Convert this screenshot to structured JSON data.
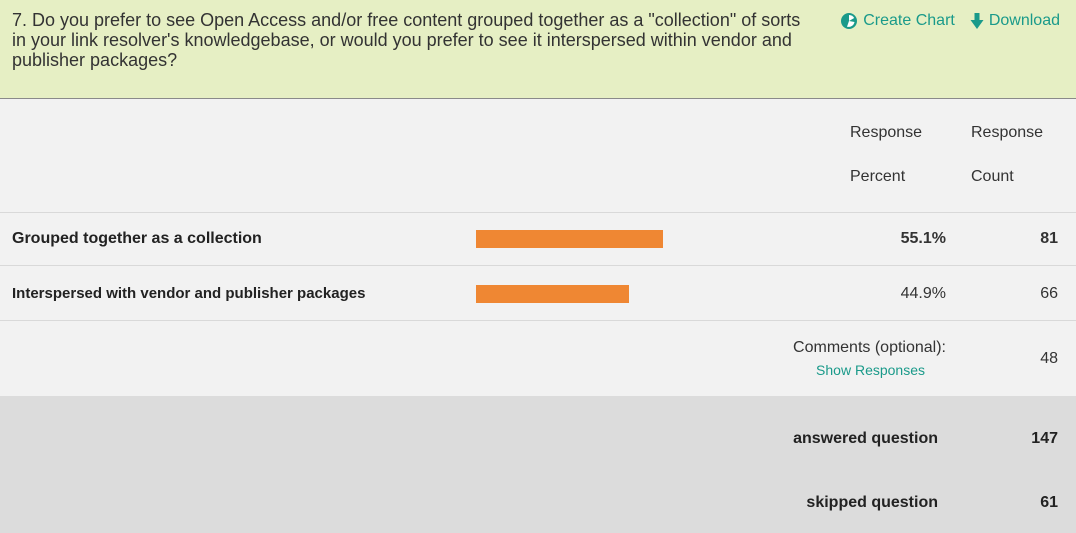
{
  "question": {
    "text": "7. Do you prefer to see Open Access and/or free content grouped together as a \"collection\" of sorts in your link resolver's knowledgebase, or would you prefer to see it interspersed within vendor and publisher packages?",
    "create_chart_label": "Create Chart",
    "download_label": "Download"
  },
  "columns": {
    "response_percent": [
      "Response",
      "Percent"
    ],
    "response_count": [
      "Response",
      "Count"
    ]
  },
  "rows": [
    {
      "label": "Grouped together as a collection",
      "percent_text": "55.1%",
      "percent": 55.1,
      "count": "81",
      "emphasized": true
    },
    {
      "label": "Interspersed with vendor and publisher packages",
      "percent_text": "44.9%",
      "percent": 44.9,
      "count": "66",
      "emphasized": false
    }
  ],
  "comments": {
    "label": "Comments (optional):",
    "link": "Show Responses",
    "count": "48"
  },
  "totals": {
    "answered_label": "answered question",
    "answered": "147",
    "skipped_label": "skipped question",
    "skipped": "61"
  },
  "colors": {
    "accent": "#1a9a8a",
    "bar": "#ef8733",
    "header_bg": "#e6efc4"
  }
}
